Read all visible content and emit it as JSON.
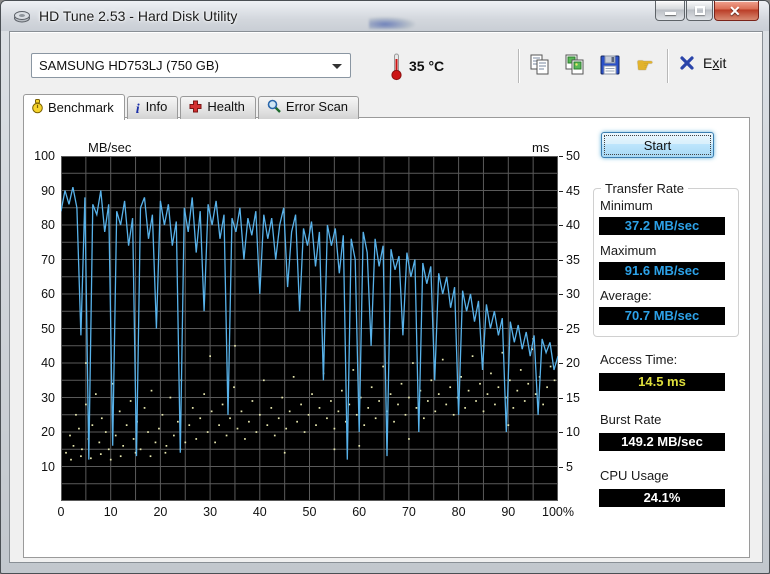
{
  "window": {
    "title": "HD Tune 2.53 - Hard Disk Utility",
    "controls": [
      "minimize",
      "maximize",
      "close"
    ]
  },
  "toolbar": {
    "drive_select": "SAMSUNG HD753LJ (750 GB)",
    "temperature": "35 °C",
    "exit": {
      "pre": "E",
      "key": "x",
      "post": "it"
    },
    "icon_names": [
      "copy-icon",
      "copy-image-icon",
      "save-icon",
      "hand-tools-icon"
    ],
    "hand_tool_glyph": "☛",
    "info_glyph": "i"
  },
  "tabs": [
    {
      "label": "Benchmark",
      "active": true
    },
    {
      "label": "Info",
      "active": false
    },
    {
      "label": "Health",
      "active": false
    },
    {
      "label": "Error Scan",
      "active": false
    }
  ],
  "panel": {
    "start_label": "Start",
    "transfer_rate": {
      "group_label": "Transfer Rate",
      "minimum_label": "Minimum",
      "minimum_value": "37.2 MB/sec",
      "maximum_label": "Maximum",
      "maximum_value": "91.6 MB/sec",
      "average_label": "Average:",
      "average_value": "70.7 MB/sec"
    },
    "access_time_label": "Access Time:",
    "access_time_value": "14.5 ms",
    "burst_rate_label": "Burst Rate",
    "burst_rate_value": "149.2 MB/sec",
    "cpu_usage_label": "CPU Usage",
    "cpu_usage_value": "24.1%"
  },
  "chart_data": {
    "type": "line",
    "title": "HD Tune benchmark graph",
    "left_axis": {
      "label": "MB/sec",
      "min": 0,
      "max": 100,
      "tick_step": 10,
      "grid_step": 5
    },
    "right_axis": {
      "label": "ms",
      "min": 0,
      "max": 50,
      "tick_step": 5
    },
    "x_axis": {
      "min": 0,
      "max": 100,
      "tick_step": 10,
      "grid_step": 5,
      "last_label_suffix": "%"
    },
    "series": [
      {
        "name": "Transfer rate",
        "unit": "MB/sec",
        "axis": "left",
        "color": "#58b2ea",
        "x_start": 0,
        "x_step": 0.8,
        "values": [
          84,
          90,
          86,
          91,
          85,
          48,
          88,
          12,
          86,
          83,
          90,
          78,
          86,
          16,
          84,
          80,
          87,
          74,
          82,
          13,
          85,
          88,
          76,
          83,
          50,
          87,
          80,
          86,
          74,
          81,
          14,
          85,
          78,
          88,
          72,
          84,
          55,
          86,
          80,
          87,
          76,
          83,
          25,
          82,
          78,
          85,
          70,
          82,
          77,
          84,
          60,
          83,
          76,
          82,
          70,
          80,
          85,
          62,
          78,
          83,
          55,
          79,
          74,
          81,
          68,
          78,
          35,
          80,
          74,
          79,
          66,
          77,
          12,
          76,
          70,
          20,
          78,
          72,
          45,
          76,
          68,
          74,
          13,
          73,
          67,
          71,
          48,
          72,
          65,
          70,
          20,
          69,
          63,
          68,
          35,
          66,
          60,
          65,
          56,
          62,
          25,
          61,
          55,
          60,
          52,
          58,
          38,
          57,
          50,
          55,
          48,
          53,
          20,
          52,
          46,
          51,
          44,
          49,
          42,
          48,
          25,
          47,
          43,
          46,
          38,
          42
        ]
      }
    ],
    "scatter": {
      "name": "Access time",
      "unit": "ms",
      "axis": "right",
      "color": "#e9e9b0",
      "points": [
        [
          1,
          7
        ],
        [
          1.8,
          9.5
        ],
        [
          2.5,
          8
        ],
        [
          3,
          12.5
        ],
        [
          3.6,
          10.5
        ],
        [
          4.2,
          7.5
        ],
        [
          5,
          14
        ],
        [
          5.5,
          9
        ],
        [
          6.3,
          11
        ],
        [
          7,
          15.5
        ],
        [
          7.7,
          8.5
        ],
        [
          8.2,
          12
        ],
        [
          9,
          10
        ],
        [
          9.6,
          7.5
        ],
        [
          10.4,
          17
        ],
        [
          11,
          9.5
        ],
        [
          11.8,
          13
        ],
        [
          12.5,
          8
        ],
        [
          13.2,
          11
        ],
        [
          14,
          14.5
        ],
        [
          14.6,
          9
        ],
        [
          15.3,
          11.5
        ],
        [
          16,
          7.5
        ],
        [
          16.8,
          13.5
        ],
        [
          17.5,
          10
        ],
        [
          18.2,
          16
        ],
        [
          19,
          8.5
        ],
        [
          19.7,
          10.5
        ],
        [
          20.4,
          12.5
        ],
        [
          21.2,
          8
        ],
        [
          22,
          15
        ],
        [
          22.7,
          9.5
        ],
        [
          23.5,
          11.5
        ],
        [
          24.2,
          17.5
        ],
        [
          25,
          8.5
        ],
        [
          25.8,
          11
        ],
        [
          26.5,
          13.5
        ],
        [
          27.2,
          9
        ],
        [
          28,
          12
        ],
        [
          28.8,
          15.5
        ],
        [
          29.5,
          10
        ],
        [
          30.3,
          13
        ],
        [
          31,
          8.5
        ],
        [
          31.8,
          11
        ],
        [
          32.5,
          14
        ],
        [
          33.3,
          9.5
        ],
        [
          34,
          12
        ],
        [
          34.8,
          16.5
        ],
        [
          35.5,
          10.5
        ],
        [
          36.3,
          13
        ],
        [
          37,
          9
        ],
        [
          37.8,
          11.5
        ],
        [
          38.5,
          14.5
        ],
        [
          39.3,
          10
        ],
        [
          40,
          12.5
        ],
        [
          40.8,
          17.5
        ],
        [
          41.5,
          11
        ],
        [
          42.3,
          13.5
        ],
        [
          43,
          9.5
        ],
        [
          43.8,
          12
        ],
        [
          44.5,
          15
        ],
        [
          45.3,
          10.5
        ],
        [
          46,
          13
        ],
        [
          46.8,
          18
        ],
        [
          47.5,
          11.5
        ],
        [
          48.3,
          14
        ],
        [
          49,
          10
        ],
        [
          49.8,
          12.5
        ],
        [
          50.5,
          15.5
        ],
        [
          51.3,
          11
        ],
        [
          52,
          13.5
        ],
        [
          52.8,
          18.5
        ],
        [
          53.5,
          12
        ],
        [
          54.3,
          14.5
        ],
        [
          55,
          10.5
        ],
        [
          55.8,
          13
        ],
        [
          56.5,
          16
        ],
        [
          57.3,
          11.5
        ],
        [
          58,
          14
        ],
        [
          58.8,
          19
        ],
        [
          59.5,
          12.5
        ],
        [
          60.3,
          15
        ],
        [
          61,
          11
        ],
        [
          61.8,
          13.5
        ],
        [
          62.5,
          16.5
        ],
        [
          63.3,
          12
        ],
        [
          64,
          14.5
        ],
        [
          64.8,
          19.5
        ],
        [
          65.5,
          13
        ],
        [
          66.3,
          15.5
        ],
        [
          67,
          11.5
        ],
        [
          67.8,
          14
        ],
        [
          68.5,
          17
        ],
        [
          69.3,
          12.5
        ],
        [
          70,
          15
        ],
        [
          70.8,
          20
        ],
        [
          71.5,
          13.5
        ],
        [
          72.3,
          16
        ],
        [
          73,
          12
        ],
        [
          73.8,
          14.5
        ],
        [
          74.5,
          17.5
        ],
        [
          75.3,
          13
        ],
        [
          76,
          15.5
        ],
        [
          76.8,
          20.5
        ],
        [
          77.5,
          14
        ],
        [
          78.3,
          16.5
        ],
        [
          79,
          12.5
        ],
        [
          79.8,
          15
        ],
        [
          80.5,
          18
        ],
        [
          81.3,
          13.5
        ],
        [
          82,
          16
        ],
        [
          82.8,
          21
        ],
        [
          83.5,
          14.5
        ],
        [
          84.3,
          17
        ],
        [
          85,
          13
        ],
        [
          85.8,
          15.5
        ],
        [
          86.5,
          18.5
        ],
        [
          87.3,
          14
        ],
        [
          88,
          16.5
        ],
        [
          88.8,
          21.5
        ],
        [
          89.5,
          15
        ],
        [
          90.3,
          17.5
        ],
        [
          91,
          13.5
        ],
        [
          91.8,
          16
        ],
        [
          92.5,
          19
        ],
        [
          93.3,
          14.5
        ],
        [
          94,
          17
        ],
        [
          94.8,
          22
        ],
        [
          95.5,
          15.5
        ],
        [
          96.3,
          18
        ],
        [
          97,
          14
        ],
        [
          97.8,
          16.5
        ],
        [
          98.5,
          19.5
        ],
        [
          99.3,
          17.5
        ],
        [
          2,
          6
        ],
        [
          4,
          6.5
        ],
        [
          6,
          6.2
        ],
        [
          8,
          6.8
        ],
        [
          10,
          6
        ],
        [
          12,
          6.5
        ],
        [
          15,
          7
        ],
        [
          18,
          6.5
        ],
        [
          21,
          7
        ],
        [
          24,
          7.5
        ],
        [
          5,
          20
        ],
        [
          30,
          21
        ],
        [
          35,
          22.5
        ],
        [
          45,
          7
        ],
        [
          55,
          7.5
        ],
        [
          60,
          8
        ],
        [
          70,
          9
        ],
        [
          85,
          22.5
        ],
        [
          90,
          11
        ],
        [
          95,
          23.5
        ]
      ]
    },
    "colors": {
      "plot_background": "#000000",
      "grid": "#5a5a5a",
      "line_blue": "#58b2ea",
      "dot_yellow": "#e9e9b0",
      "value_blue": "#2da2e8",
      "value_yellow": "#dede3c",
      "value_white": "#ffffff"
    },
    "legend_position": "none",
    "grid": true
  }
}
